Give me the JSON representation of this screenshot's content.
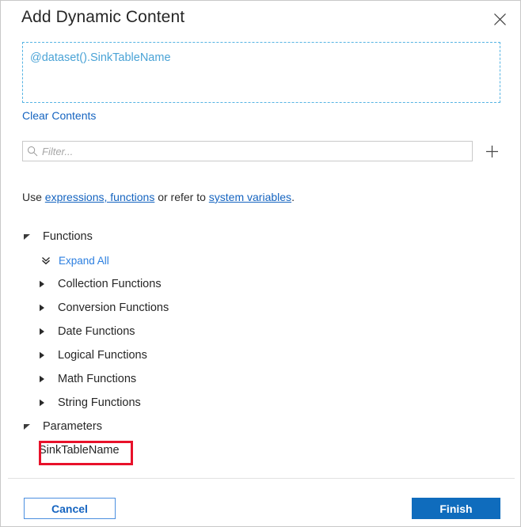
{
  "dialog": {
    "title": "Add Dynamic Content",
    "close_icon": "close-icon"
  },
  "expression": {
    "value": "@dataset().SinkTableName",
    "clear_label": "Clear Contents",
    "text_color": "#4aa3d6",
    "border_color": "#56b4e3"
  },
  "filter": {
    "placeholder": "Filter...",
    "value": "",
    "search_icon": "search-icon",
    "add_icon": "plus-icon"
  },
  "hint": {
    "prefix": "Use ",
    "link1": "expressions, functions",
    "middle": " or refer to ",
    "link2": "system variables",
    "suffix": "."
  },
  "tree": {
    "functions": {
      "label": "Functions",
      "expanded": true,
      "expand_all_label": "Expand All",
      "children": [
        {
          "label": "Collection Functions",
          "expanded": false
        },
        {
          "label": "Conversion Functions",
          "expanded": false
        },
        {
          "label": "Date Functions",
          "expanded": false
        },
        {
          "label": "Logical Functions",
          "expanded": false
        },
        {
          "label": "Math Functions",
          "expanded": false
        },
        {
          "label": "String Functions",
          "expanded": false
        }
      ]
    },
    "parameters": {
      "label": "Parameters",
      "expanded": true,
      "children": [
        {
          "label": "SinkTableName",
          "highlighted": true
        }
      ]
    }
  },
  "footer": {
    "cancel_label": "Cancel",
    "finish_label": "Finish",
    "finish_color": "#0f6cbd",
    "cancel_color": "#1564c0"
  },
  "annotation": {
    "highlight_color": "#e8112a"
  }
}
